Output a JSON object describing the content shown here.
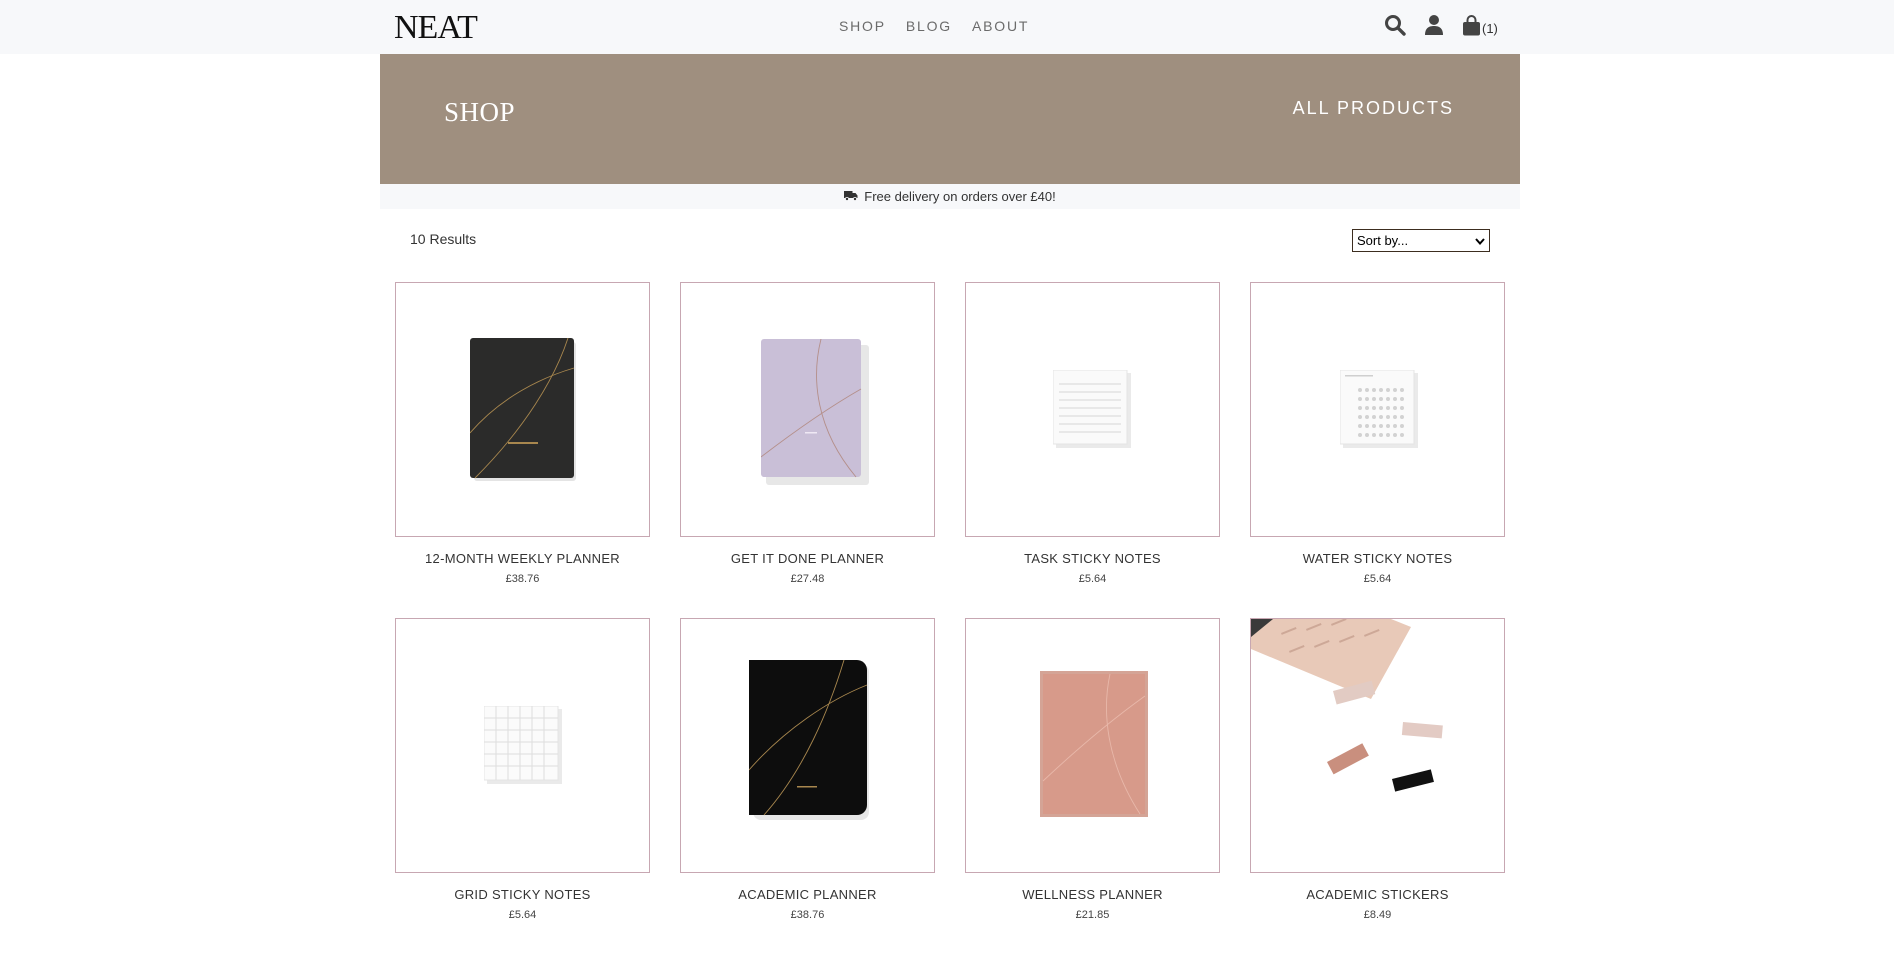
{
  "header": {
    "logo": "NEAT",
    "nav": [
      {
        "label": "SHOP"
      },
      {
        "label": "BLOG"
      },
      {
        "label": "ABOUT"
      }
    ],
    "cart_count": "(1)",
    "icons": [
      "search-icon",
      "user-icon",
      "shopping-bag-icon"
    ]
  },
  "hero": {
    "title": "SHOP",
    "filter_label": "ALL PRODUCTS"
  },
  "promo": {
    "text": "Free delivery on orders over £40!",
    "icon": "truck-icon"
  },
  "listing": {
    "results": "10 Results",
    "sort_selected": "Sort by..."
  },
  "products": [
    {
      "name": "12-MONTH WEEKLY PLANNER",
      "price": "£38.76"
    },
    {
      "name": "GET IT DONE PLANNER",
      "price": "£27.48"
    },
    {
      "name": "TASK STICKY NOTES",
      "price": "£5.64"
    },
    {
      "name": "WATER STICKY NOTES",
      "price": "£5.64"
    },
    {
      "name": "GRID STICKY NOTES",
      "price": "£5.64"
    },
    {
      "name": "ACADEMIC PLANNER",
      "price": "£38.76"
    },
    {
      "name": "WELLNESS PLANNER",
      "price": "£21.85"
    },
    {
      "name": "ACADEMIC STICKERS",
      "price": "£8.49"
    }
  ],
  "colors": {
    "hero_bg": "#9f8f7f",
    "card_border": "#c7a7b2",
    "topbar_bg": "#f7f8fa"
  }
}
